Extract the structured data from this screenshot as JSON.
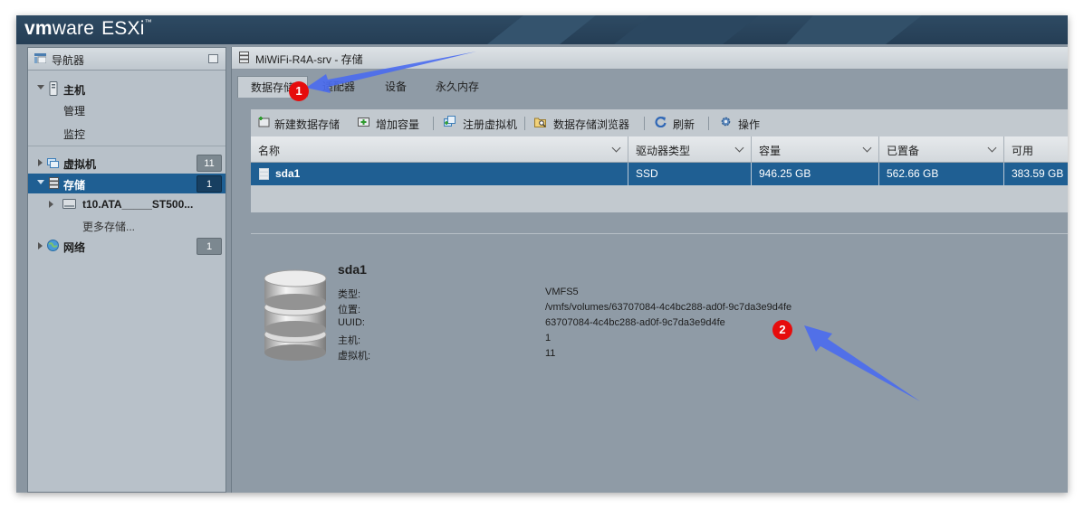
{
  "header": {
    "brand_vm": "vm",
    "brand_ware": "ware",
    "brand_product": "ESXi",
    "brand_tm": "™"
  },
  "navigator": {
    "title": "导航器",
    "host": {
      "label": "主机",
      "children": [
        "管理",
        "监控"
      ]
    },
    "vms": {
      "label": "虚拟机",
      "count": "11"
    },
    "storage": {
      "label": "存储",
      "count": "1",
      "children": [
        "t10.ATA_____ST500...",
        "更多存储..."
      ]
    },
    "network": {
      "label": "网络",
      "count": "1"
    }
  },
  "main": {
    "title": "MiWiFi-R4A-srv - 存储",
    "tabs": [
      "数据存储",
      "适配器",
      "设备",
      "永久内存"
    ],
    "toolbar": [
      "新建数据存储",
      "增加容量",
      "注册虚拟机",
      "数据存储浏览器",
      "刷新",
      "操作"
    ],
    "table": {
      "columns": [
        "名称",
        "驱动器类型",
        "容量",
        "已置备",
        "可用"
      ],
      "rows": [
        {
          "name": "sda1",
          "drive_type": "SSD",
          "capacity": "946.25 GB",
          "provisioned": "562.66 GB",
          "free": "383.59 GB"
        }
      ]
    },
    "detail": {
      "title": "sda1",
      "fields": [
        {
          "label": "类型:",
          "value": "VMFS5"
        },
        {
          "label": "位置:",
          "value": "/vmfs/volumes/63707084-4c4bc288-ad0f-9c7da3e9d4fe"
        },
        {
          "label": "UUID:",
          "value": "63707084-4c4bc288-ad0f-9c7da3e9d4fe"
        },
        {
          "label": "主机:",
          "value": "1"
        },
        {
          "label": "虚拟机:",
          "value": "11"
        }
      ]
    }
  },
  "annotations": {
    "marker_1": "1",
    "marker_2": "2"
  },
  "colors": {
    "selection": "#1f5f93",
    "header": "#2e4a63",
    "annotation_arrow": "#4a6cf0",
    "marker": "#e60c0c"
  }
}
